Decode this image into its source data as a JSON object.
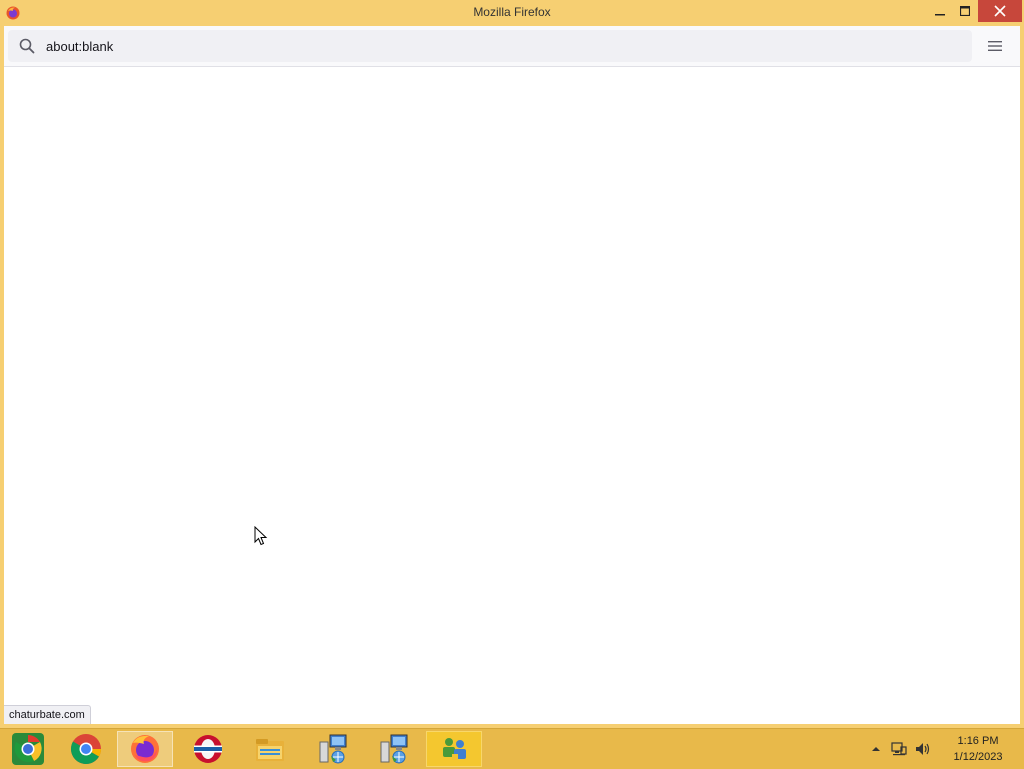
{
  "window": {
    "title": "Mozilla Firefox",
    "accent_color": "#f6cf72",
    "close_color": "#c7473b"
  },
  "toolbar": {
    "url_value": "about:blank",
    "search_icon": "search-icon",
    "menu_icon": "hamburger-menu-icon"
  },
  "status": {
    "link_text": "chaturbate.com"
  },
  "taskbar": {
    "color": "#e8b94a",
    "items": [
      {
        "name": "chrome-canary-app",
        "icon": "chrome-canary-icon"
      },
      {
        "name": "chrome-app",
        "icon": "chrome-icon"
      },
      {
        "name": "firefox-app",
        "icon": "firefox-icon",
        "active": true
      },
      {
        "name": "opera-app",
        "icon": "opera-icon"
      },
      {
        "name": "file-explorer-app",
        "icon": "folder-icon"
      },
      {
        "name": "network-setup-app-1",
        "icon": "network-computer-icon"
      },
      {
        "name": "network-setup-app-2",
        "icon": "network-computer-icon"
      },
      {
        "name": "users-app",
        "icon": "users-icon",
        "highlight": true
      }
    ],
    "tray": {
      "show_hidden_icon": "chevron-up-icon",
      "network_icon": "network-icon",
      "volume_icon": "speaker-icon"
    },
    "clock": {
      "time": "1:16 PM",
      "date": "1/12/2023"
    }
  }
}
